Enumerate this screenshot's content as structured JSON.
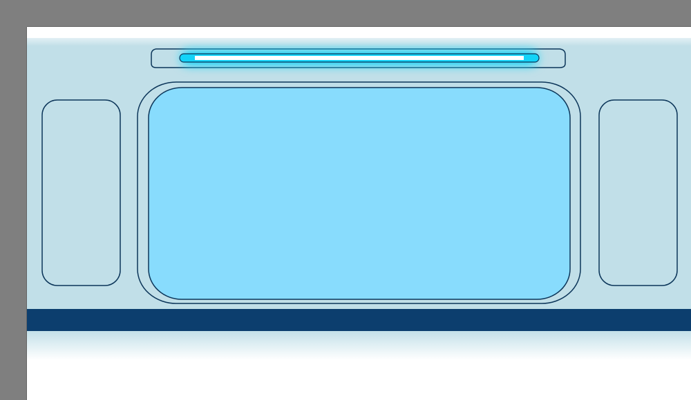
{
  "colors": {
    "canvas_border": "#7f7f7f",
    "canvas_border_line": "#666666",
    "page_background": "#ffffff",
    "panel_fill": "#c1dfe8",
    "outline": "#0b3559",
    "window_fill": "#88dcfd",
    "bottom_stripe": "#0c3e6e",
    "light_glow": "#13d3f8",
    "light_tube": "#ffffff"
  },
  "scene": {
    "description_icon": "train-car-window-icon",
    "elements": {
      "light_fixture": "ceiling-light",
      "center_window": "main-window",
      "left_panel": "side-panel-left",
      "right_panel": "side-panel-right",
      "stripe": "floor-stripe"
    }
  }
}
